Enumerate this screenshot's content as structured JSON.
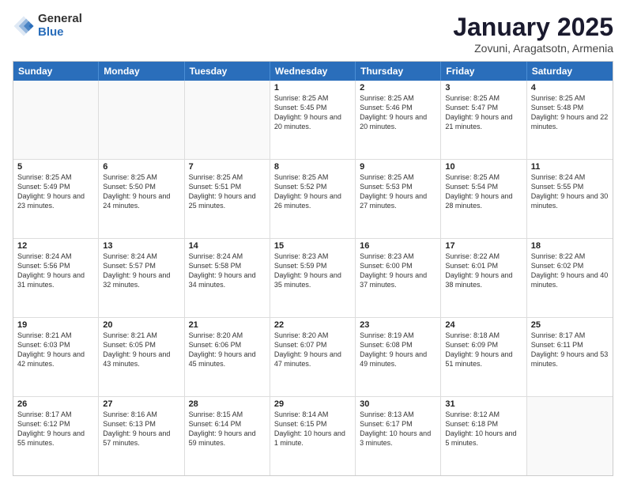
{
  "logo": {
    "general": "General",
    "blue": "Blue"
  },
  "title": {
    "month": "January 2025",
    "location": "Zovuni, Aragatsotn, Armenia"
  },
  "days": [
    "Sunday",
    "Monday",
    "Tuesday",
    "Wednesday",
    "Thursday",
    "Friday",
    "Saturday"
  ],
  "rows": [
    [
      {
        "day": "",
        "sunrise": "",
        "sunset": "",
        "daylight": "",
        "empty": true
      },
      {
        "day": "",
        "sunrise": "",
        "sunset": "",
        "daylight": "",
        "empty": true
      },
      {
        "day": "",
        "sunrise": "",
        "sunset": "",
        "daylight": "",
        "empty": true
      },
      {
        "day": "1",
        "sunrise": "Sunrise: 8:25 AM",
        "sunset": "Sunset: 5:45 PM",
        "daylight": "Daylight: 9 hours and 20 minutes."
      },
      {
        "day": "2",
        "sunrise": "Sunrise: 8:25 AM",
        "sunset": "Sunset: 5:46 PM",
        "daylight": "Daylight: 9 hours and 20 minutes."
      },
      {
        "day": "3",
        "sunrise": "Sunrise: 8:25 AM",
        "sunset": "Sunset: 5:47 PM",
        "daylight": "Daylight: 9 hours and 21 minutes."
      },
      {
        "day": "4",
        "sunrise": "Sunrise: 8:25 AM",
        "sunset": "Sunset: 5:48 PM",
        "daylight": "Daylight: 9 hours and 22 minutes."
      }
    ],
    [
      {
        "day": "5",
        "sunrise": "Sunrise: 8:25 AM",
        "sunset": "Sunset: 5:49 PM",
        "daylight": "Daylight: 9 hours and 23 minutes."
      },
      {
        "day": "6",
        "sunrise": "Sunrise: 8:25 AM",
        "sunset": "Sunset: 5:50 PM",
        "daylight": "Daylight: 9 hours and 24 minutes."
      },
      {
        "day": "7",
        "sunrise": "Sunrise: 8:25 AM",
        "sunset": "Sunset: 5:51 PM",
        "daylight": "Daylight: 9 hours and 25 minutes."
      },
      {
        "day": "8",
        "sunrise": "Sunrise: 8:25 AM",
        "sunset": "Sunset: 5:52 PM",
        "daylight": "Daylight: 9 hours and 26 minutes."
      },
      {
        "day": "9",
        "sunrise": "Sunrise: 8:25 AM",
        "sunset": "Sunset: 5:53 PM",
        "daylight": "Daylight: 9 hours and 27 minutes."
      },
      {
        "day": "10",
        "sunrise": "Sunrise: 8:25 AM",
        "sunset": "Sunset: 5:54 PM",
        "daylight": "Daylight: 9 hours and 28 minutes."
      },
      {
        "day": "11",
        "sunrise": "Sunrise: 8:24 AM",
        "sunset": "Sunset: 5:55 PM",
        "daylight": "Daylight: 9 hours and 30 minutes."
      }
    ],
    [
      {
        "day": "12",
        "sunrise": "Sunrise: 8:24 AM",
        "sunset": "Sunset: 5:56 PM",
        "daylight": "Daylight: 9 hours and 31 minutes."
      },
      {
        "day": "13",
        "sunrise": "Sunrise: 8:24 AM",
        "sunset": "Sunset: 5:57 PM",
        "daylight": "Daylight: 9 hours and 32 minutes."
      },
      {
        "day": "14",
        "sunrise": "Sunrise: 8:24 AM",
        "sunset": "Sunset: 5:58 PM",
        "daylight": "Daylight: 9 hours and 34 minutes."
      },
      {
        "day": "15",
        "sunrise": "Sunrise: 8:23 AM",
        "sunset": "Sunset: 5:59 PM",
        "daylight": "Daylight: 9 hours and 35 minutes."
      },
      {
        "day": "16",
        "sunrise": "Sunrise: 8:23 AM",
        "sunset": "Sunset: 6:00 PM",
        "daylight": "Daylight: 9 hours and 37 minutes."
      },
      {
        "day": "17",
        "sunrise": "Sunrise: 8:22 AM",
        "sunset": "Sunset: 6:01 PM",
        "daylight": "Daylight: 9 hours and 38 minutes."
      },
      {
        "day": "18",
        "sunrise": "Sunrise: 8:22 AM",
        "sunset": "Sunset: 6:02 PM",
        "daylight": "Daylight: 9 hours and 40 minutes."
      }
    ],
    [
      {
        "day": "19",
        "sunrise": "Sunrise: 8:21 AM",
        "sunset": "Sunset: 6:03 PM",
        "daylight": "Daylight: 9 hours and 42 minutes."
      },
      {
        "day": "20",
        "sunrise": "Sunrise: 8:21 AM",
        "sunset": "Sunset: 6:05 PM",
        "daylight": "Daylight: 9 hours and 43 minutes."
      },
      {
        "day": "21",
        "sunrise": "Sunrise: 8:20 AM",
        "sunset": "Sunset: 6:06 PM",
        "daylight": "Daylight: 9 hours and 45 minutes."
      },
      {
        "day": "22",
        "sunrise": "Sunrise: 8:20 AM",
        "sunset": "Sunset: 6:07 PM",
        "daylight": "Daylight: 9 hours and 47 minutes."
      },
      {
        "day": "23",
        "sunrise": "Sunrise: 8:19 AM",
        "sunset": "Sunset: 6:08 PM",
        "daylight": "Daylight: 9 hours and 49 minutes."
      },
      {
        "day": "24",
        "sunrise": "Sunrise: 8:18 AM",
        "sunset": "Sunset: 6:09 PM",
        "daylight": "Daylight: 9 hours and 51 minutes."
      },
      {
        "day": "25",
        "sunrise": "Sunrise: 8:17 AM",
        "sunset": "Sunset: 6:11 PM",
        "daylight": "Daylight: 9 hours and 53 minutes."
      }
    ],
    [
      {
        "day": "26",
        "sunrise": "Sunrise: 8:17 AM",
        "sunset": "Sunset: 6:12 PM",
        "daylight": "Daylight: 9 hours and 55 minutes."
      },
      {
        "day": "27",
        "sunrise": "Sunrise: 8:16 AM",
        "sunset": "Sunset: 6:13 PM",
        "daylight": "Daylight: 9 hours and 57 minutes."
      },
      {
        "day": "28",
        "sunrise": "Sunrise: 8:15 AM",
        "sunset": "Sunset: 6:14 PM",
        "daylight": "Daylight: 9 hours and 59 minutes."
      },
      {
        "day": "29",
        "sunrise": "Sunrise: 8:14 AM",
        "sunset": "Sunset: 6:15 PM",
        "daylight": "Daylight: 10 hours and 1 minute."
      },
      {
        "day": "30",
        "sunrise": "Sunrise: 8:13 AM",
        "sunset": "Sunset: 6:17 PM",
        "daylight": "Daylight: 10 hours and 3 minutes."
      },
      {
        "day": "31",
        "sunrise": "Sunrise: 8:12 AM",
        "sunset": "Sunset: 6:18 PM",
        "daylight": "Daylight: 10 hours and 5 minutes."
      },
      {
        "day": "",
        "sunrise": "",
        "sunset": "",
        "daylight": "",
        "empty": true
      }
    ]
  ]
}
